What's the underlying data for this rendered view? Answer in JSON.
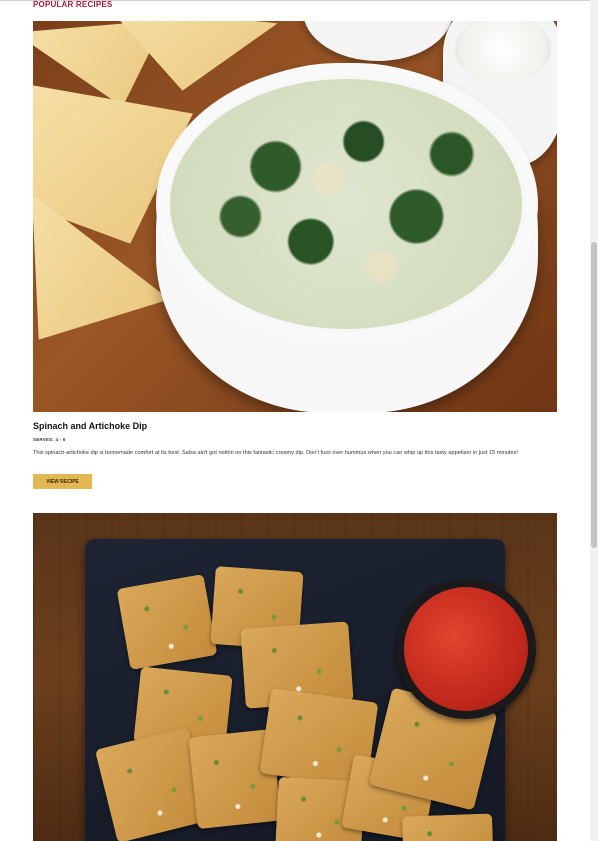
{
  "section": {
    "title": "POPULAR RECIPES"
  },
  "recipes": [
    {
      "title": "Spinach and Artichoke Dip",
      "serves": "SERVES: 4 - 6",
      "description": "This spinach-artichoke dip is homemade comfort at its best. Salsa ain't got nothin on this fantastic creamy dip. Don't fuss over hummus when you can whip up this tasty appetizer in just 15 minutes!",
      "button_label": "VIEW RECIPE"
    }
  ],
  "colors": {
    "accent": "#9b1e3a",
    "button": "#e1b851"
  }
}
